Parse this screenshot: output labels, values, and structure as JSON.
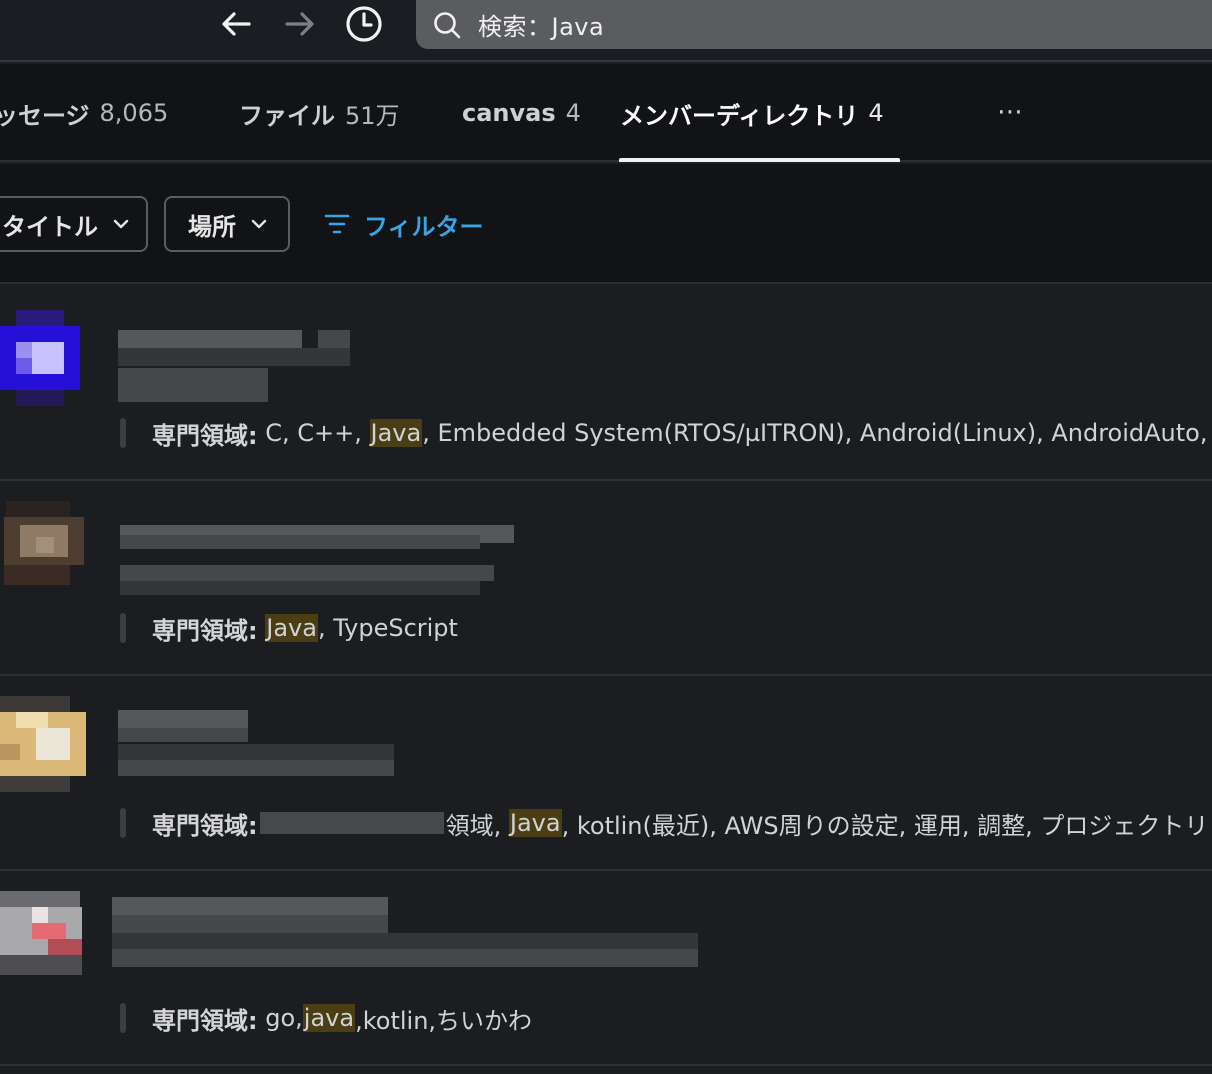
{
  "search": {
    "text": "検索：Java"
  },
  "nav": {
    "back": "back-arrow-icon",
    "forward": "forward-arrow-icon",
    "history": "clock-icon"
  },
  "tabs": [
    {
      "label": "ッセージ",
      "count": "8,065"
    },
    {
      "label": "ファイル",
      "count": "51万"
    },
    {
      "label": "canvas",
      "count": "4"
    },
    {
      "label": "メンバーディレクトリ",
      "count": "4",
      "active": true
    }
  ],
  "more": "⋯",
  "filters": {
    "title_dropdown": "タイトル",
    "location_dropdown": "場所",
    "filter_button": "フィルター"
  },
  "results": [
    {
      "expertise_label": "専門領域:",
      "before": " C, C++, ",
      "highlight": "Java",
      "after": ", Embedded System(RTOS/µITRON), Android(Linux), AndroidAuto, App"
    },
    {
      "expertise_label": "専門領域:",
      "before": " ",
      "highlight": "Java",
      "after": ", TypeScript"
    },
    {
      "expertise_label": "専門領域:",
      "before": "領域, ",
      "highlight": "Java",
      "after": ", kotlin(最近), AWS周りの設定, 運用, 調整, プロジェクトリ"
    },
    {
      "expertise_label": "専門領域:",
      "before": " go,",
      "highlight": "java",
      "after": ",kotlin,ちいかわ"
    }
  ],
  "colors": {
    "highlight": "#f2c744",
    "accent": "#3aa3e3",
    "background": "#1b1d21"
  }
}
